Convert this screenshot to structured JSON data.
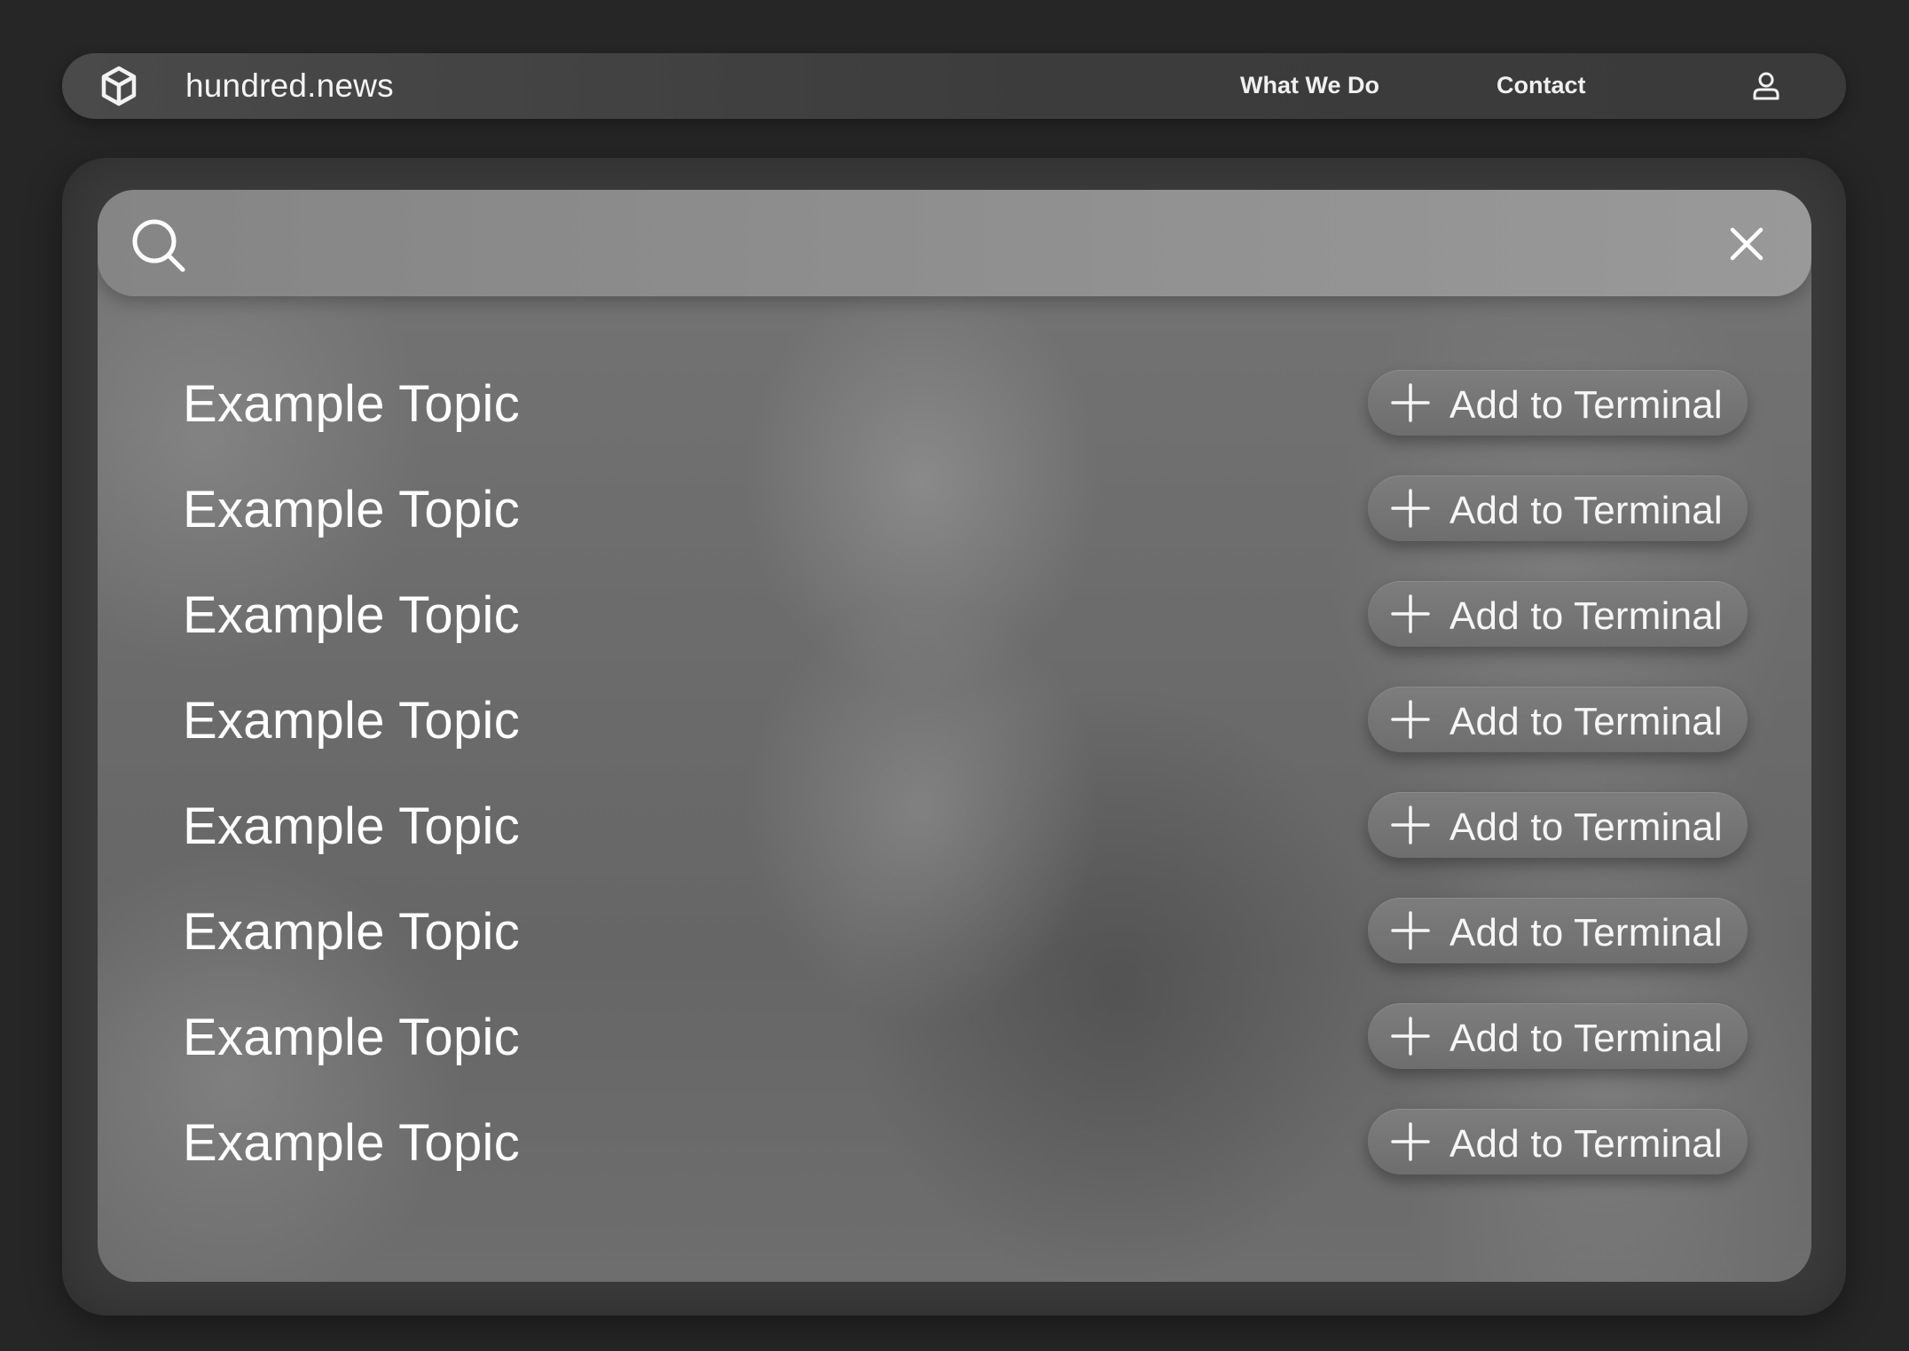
{
  "header": {
    "brand": "hundred.news",
    "nav": [
      {
        "label": "What We Do"
      },
      {
        "label": "Contact"
      }
    ],
    "icons": {
      "logo": "cube-icon",
      "user": "user-icon"
    }
  },
  "search": {
    "value": "",
    "placeholder": "",
    "icons": {
      "search": "search-icon",
      "clear": "close-icon"
    }
  },
  "topics": [
    {
      "title": "Example Topic",
      "action": "Add to Terminal"
    },
    {
      "title": "Example Topic",
      "action": "Add to Terminal"
    },
    {
      "title": "Example Topic",
      "action": "Add to Terminal"
    },
    {
      "title": "Example Topic",
      "action": "Add to Terminal"
    },
    {
      "title": "Example Topic",
      "action": "Add to Terminal"
    },
    {
      "title": "Example Topic",
      "action": "Add to Terminal"
    },
    {
      "title": "Example Topic",
      "action": "Add to Terminal"
    },
    {
      "title": "Example Topic",
      "action": "Add to Terminal"
    }
  ],
  "colors": {
    "page_background": "#262626",
    "navbar": "#424242",
    "panel": "#6e6e6e",
    "search_bar": "#8f8f8f",
    "button": "#757575",
    "text": "#ffffff"
  }
}
